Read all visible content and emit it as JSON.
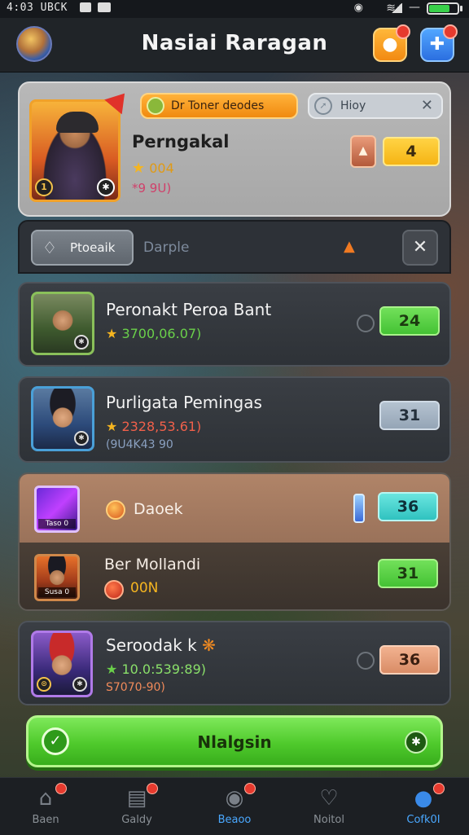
{
  "status_bar": {
    "time": "4:03 UBCK"
  },
  "header": {
    "title": "Nasiai Raragan"
  },
  "featured": {
    "name": "Perngakal",
    "stat": "004",
    "sub": "*9 9U)",
    "filter_chip": "Dr Toner deodes",
    "search_chip": "Hioy",
    "rank_value": "4",
    "level_badge": "1"
  },
  "filter_bar": {
    "tab_active": "Ptoeaik",
    "tab_inactive": "Darple"
  },
  "rows": [
    {
      "name": "Peronakt Peroa Bant",
      "stat": "3700,06.07)",
      "stat_color": "#6ad04a",
      "badge": "24",
      "badge_style": "green"
    },
    {
      "name": "Purligata Pemingas",
      "stat": "2328,53.61)",
      "stat_color": "#f0604a",
      "sub": "(9U4K43 90",
      "badge": "31",
      "badge_style": "bluegrey"
    }
  ],
  "group_rows": [
    {
      "name": "Daoek",
      "caption": "Taso 0",
      "badge": "36",
      "badge_style": "cyan"
    },
    {
      "name": "Ber Mollandi",
      "stat": "00N",
      "caption": "Susa 0",
      "badge": "31",
      "badge_style": "green"
    }
  ],
  "last_row": {
    "name": "Seroodak k",
    "stat": "10.0:539:89)",
    "sub": "S7070-90)",
    "badge": "36",
    "badge_style": "salmon"
  },
  "cta": {
    "label": "Nlalgsin"
  },
  "tabs": [
    {
      "label": "Baen",
      "icon": "home-icon",
      "active": false
    },
    {
      "label": "Galdy",
      "icon": "inbox-icon",
      "active": false
    },
    {
      "label": "Beaoo",
      "icon": "battle-icon",
      "active": false
    },
    {
      "label": "Noitol",
      "icon": "heart-icon",
      "active": false
    },
    {
      "label": "Cofk0I",
      "icon": "profile-icon",
      "active": true
    }
  ],
  "colors": {
    "accent_green": "#4fca2c",
    "accent_orange": "#f28a12",
    "accent_blue": "#2b6fe0"
  }
}
